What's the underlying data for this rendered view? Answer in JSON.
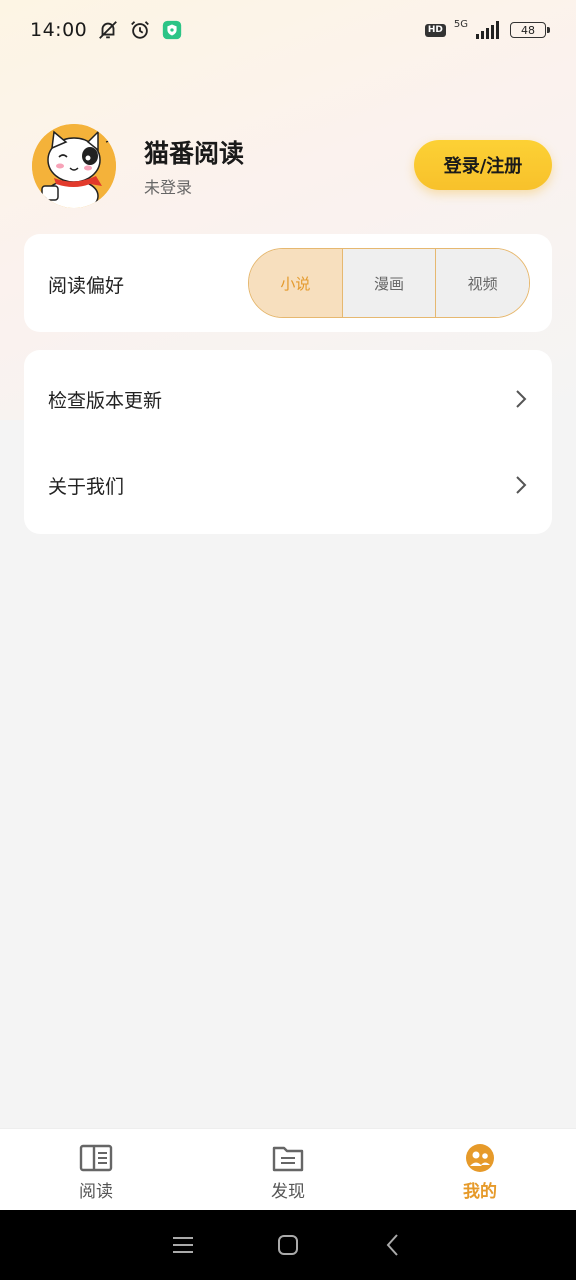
{
  "status_bar": {
    "time": "14:00",
    "network": "5G",
    "hd": "HD",
    "battery": "48"
  },
  "profile": {
    "app_name": "猫番阅读",
    "login_state": "未登录",
    "login_button": "登录/注册"
  },
  "preference": {
    "label": "阅读偏好",
    "options": [
      "小说",
      "漫画",
      "视频"
    ],
    "selected": "小说"
  },
  "menu": {
    "items": [
      {
        "label": "检查版本更新"
      },
      {
        "label": "关于我们"
      }
    ]
  },
  "bottom_nav": {
    "items": [
      {
        "label": "阅读",
        "icon": "book-icon"
      },
      {
        "label": "发现",
        "icon": "folder-icon"
      },
      {
        "label": "我的",
        "icon": "profile-icon"
      }
    ],
    "active": "我的"
  },
  "colors": {
    "accent": "#e69a2a",
    "button": "#fcd135"
  }
}
